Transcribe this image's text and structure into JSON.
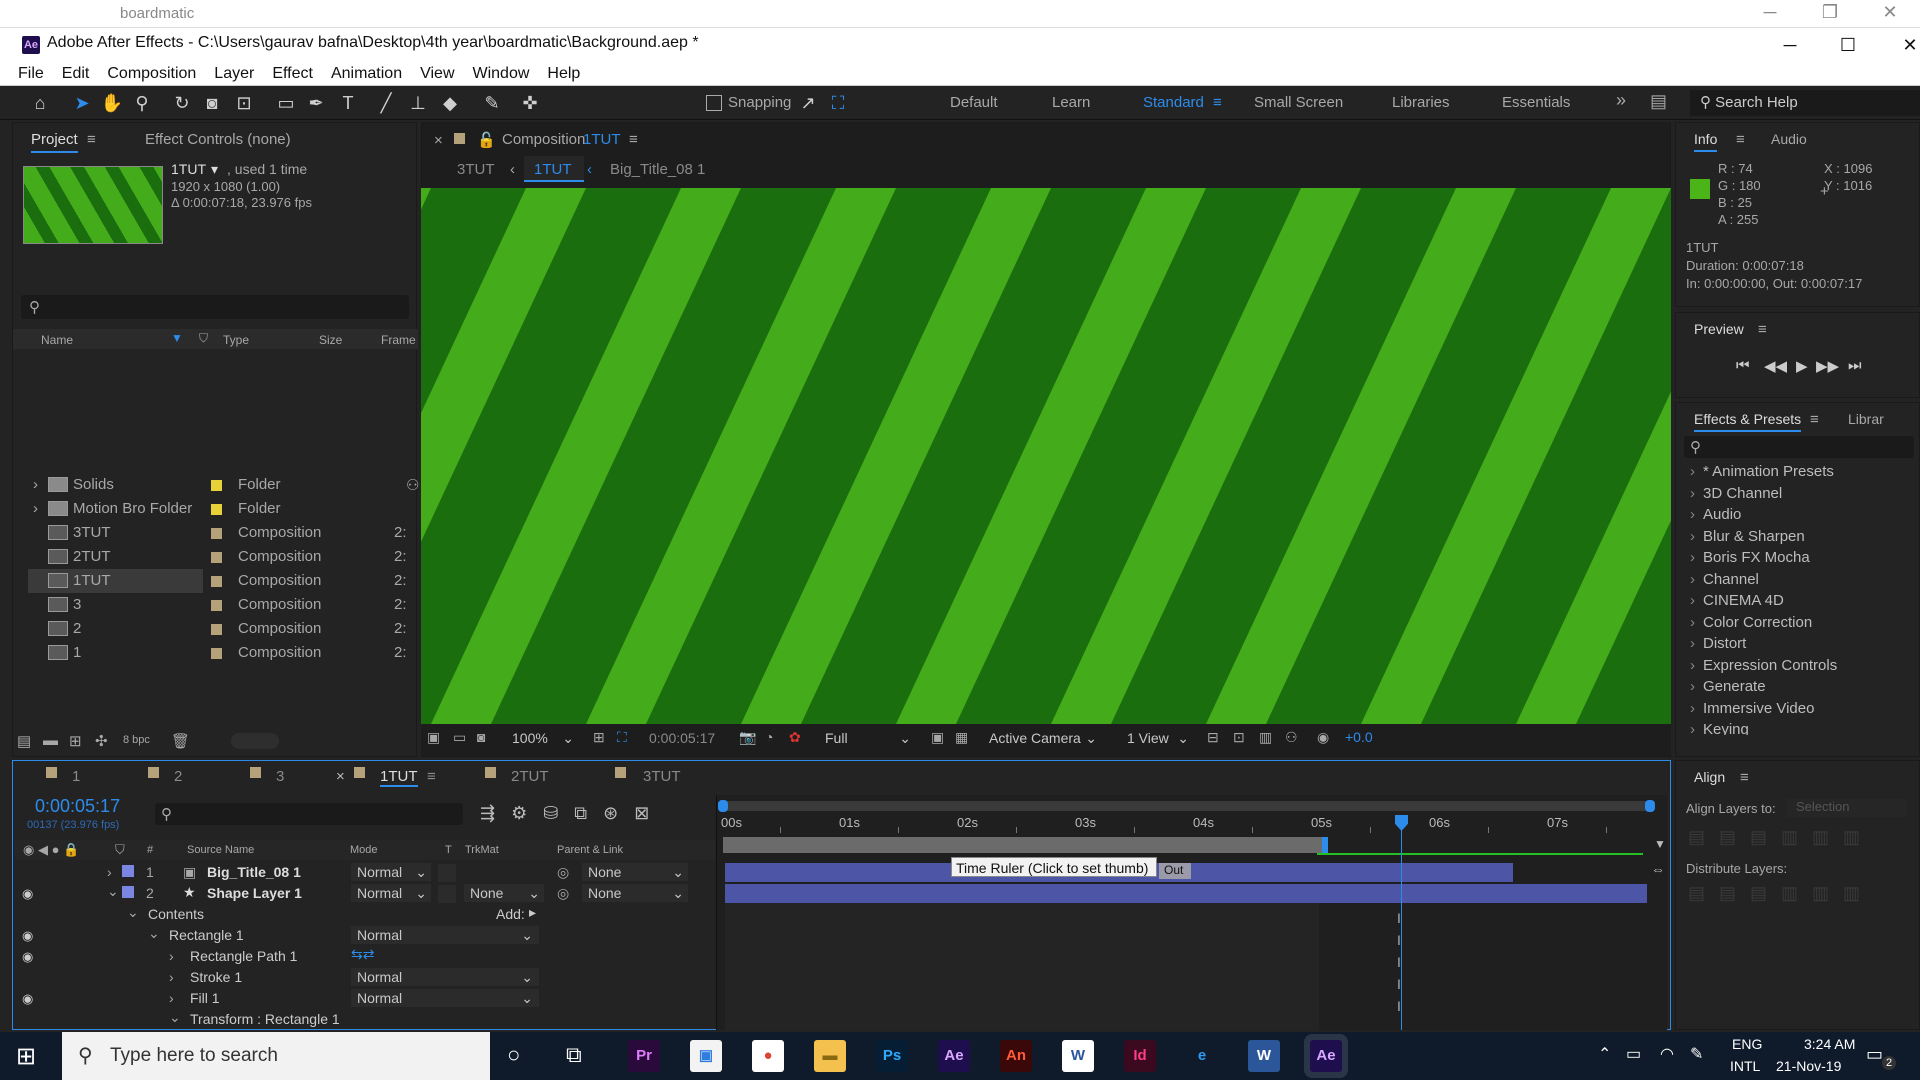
{
  "explorer": {
    "title": "boardmatic"
  },
  "window": {
    "title": "Adobe After Effects - C:\\Users\\gaurav bafna\\Desktop\\4th year\\boardmatic\\Background.aep *",
    "logo": "Ae"
  },
  "menu": [
    "File",
    "Edit",
    "Composition",
    "Layer",
    "Effect",
    "Animation",
    "View",
    "Window",
    "Help"
  ],
  "toolbar": {
    "snapping": "Snapping",
    "workspaces": [
      "Default",
      "Learn",
      "Standard",
      "Small Screen",
      "Libraries",
      "Essentials"
    ],
    "active_workspace": "Standard",
    "search": "Search Help"
  },
  "project": {
    "tab": "Project",
    "tab2": "Effect Controls (none)",
    "item_name": "1TUT",
    "used": ", used 1 time",
    "dims": "1920 x 1080 (1.00)",
    "duration": "Δ 0:00:07:18, 23.976 fps",
    "cols": {
      "name": "Name",
      "type": "Type",
      "size": "Size",
      "frame": "Frame"
    },
    "items": [
      {
        "name": "Solids",
        "type": "Folder",
        "color": "#e8d23a",
        "sz": ""
      },
      {
        "name": "Motion Bro Folder",
        "type": "Folder",
        "color": "#e8d23a",
        "sz": ""
      },
      {
        "name": "3TUT",
        "type": "Composition",
        "color": "#b5a27a",
        "sz": "2:"
      },
      {
        "name": "2TUT",
        "type": "Composition",
        "color": "#b5a27a",
        "sz": "2:"
      },
      {
        "name": "1TUT",
        "type": "Composition",
        "color": "#b5a27a",
        "sz": "2:"
      },
      {
        "name": "3",
        "type": "Composition",
        "color": "#b5a27a",
        "sz": "2:"
      },
      {
        "name": "2",
        "type": "Composition",
        "color": "#b5a27a",
        "sz": "2:"
      },
      {
        "name": "1",
        "type": "Composition",
        "color": "#b5a27a",
        "sz": "2:"
      }
    ],
    "bpc": "8 bpc"
  },
  "comp": {
    "tab_prefix": "Composition",
    "tab_name": "1TUT",
    "crumbs": [
      "3TUT",
      "1TUT",
      "Big_Title_08 1"
    ],
    "zoom": "100%",
    "time": "0:00:05:17",
    "res": "Full",
    "camera": "Active Camera",
    "view": "1 View",
    "exposure": "+0.0",
    "stripe_light": "#44ab1b",
    "stripe_dark": "#1a6e0e"
  },
  "info": {
    "tab": "Info",
    "tab2": "Audio",
    "r": "R : 74",
    "g": "G : 180",
    "b": "B : 25",
    "a": "A : 255",
    "x": "X : 1096",
    "y": "Y : 1016",
    "name": "1TUT",
    "dur": "Duration: 0:00:07:18",
    "inout": "In: 0:00:00:00, Out: 0:00:07:17"
  },
  "preview": {
    "title": "Preview"
  },
  "effects": {
    "tab": "Effects & Presets",
    "tab2": "Librar",
    "items": [
      "* Animation Presets",
      "3D Channel",
      "Audio",
      "Blur & Sharpen",
      "Boris FX Mocha",
      "Channel",
      "CINEMA 4D",
      "Color Correction",
      "Distort",
      "Expression Controls",
      "Generate",
      "Immersive Video",
      "Keying"
    ]
  },
  "align": {
    "title": "Align",
    "to": "Align Layers to:",
    "sel": "Selection",
    "dist": "Distribute Layers:"
  },
  "timeline": {
    "tabs": [
      "1",
      "2",
      "3",
      "1TUT",
      "2TUT",
      "3TUT"
    ],
    "time": "0:00:05:17",
    "frames": "00137 (23.976 fps)",
    "cols": {
      "src": "Source Name",
      "mode": "Mode",
      "t": "T",
      "trk": "TrkMat",
      "parent": "Parent & Link"
    },
    "ruler": [
      "00s",
      "01s",
      "02s",
      "03s",
      "04s",
      "05s",
      "06s",
      "07s"
    ],
    "layers": [
      {
        "num": "1",
        "name": "Big_Title_08 1",
        "mode": "Normal",
        "trk": "",
        "parent": "None"
      },
      {
        "num": "2",
        "name": "Shape Layer 1",
        "mode": "Normal",
        "trk": "None",
        "parent": "None"
      }
    ],
    "contents": "Contents",
    "add": "Add:",
    "rect": "Rectangle 1",
    "rect_mode": "Normal",
    "path": "Rectangle Path 1",
    "stroke": "Stroke 1",
    "stroke_mode": "Normal",
    "fill": "Fill 1",
    "fill_mode": "Normal",
    "transform": "Transform : Rectangle 1",
    "tooltip": "Time Ruler (Click to set thumb)",
    "out": "Out"
  },
  "taskbar": {
    "search": "Type here to search",
    "lang1": "ENG",
    "lang2": "INTL",
    "time": "3:24 AM",
    "date": "21-Nov-19",
    "notif": "2",
    "apps": [
      {
        "l": "Pr",
        "bg": "#2a0a3a",
        "fg": "#e07cff"
      },
      {
        "l": "▣",
        "bg": "#f3f3f3",
        "fg": "#2f7de1"
      },
      {
        "l": "●",
        "bg": "#ffffff",
        "fg": "#db4437"
      },
      {
        "l": "▬",
        "bg": "#f4c04e",
        "fg": "#8a6a10"
      },
      {
        "l": "Ps",
        "bg": "#061e33",
        "fg": "#31a8ff"
      },
      {
        "l": "Ae",
        "bg": "#1f0e4d",
        "fg": "#d8a7ff"
      },
      {
        "l": "An",
        "bg": "#3a0808",
        "fg": "#ff5b3a"
      },
      {
        "l": "W",
        "bg": "#ffffff",
        "fg": "#2b579a"
      },
      {
        "l": "Id",
        "bg": "#3b0a1f",
        "fg": "#ff3c87"
      },
      {
        "l": "e",
        "bg": "#0f1a2a",
        "fg": "#2e9bf0"
      },
      {
        "l": "W",
        "bg": "#2b579a",
        "fg": "#ffffff"
      },
      {
        "l": "Ae",
        "bg": "#1f0e4d",
        "fg": "#d8a7ff"
      }
    ]
  }
}
